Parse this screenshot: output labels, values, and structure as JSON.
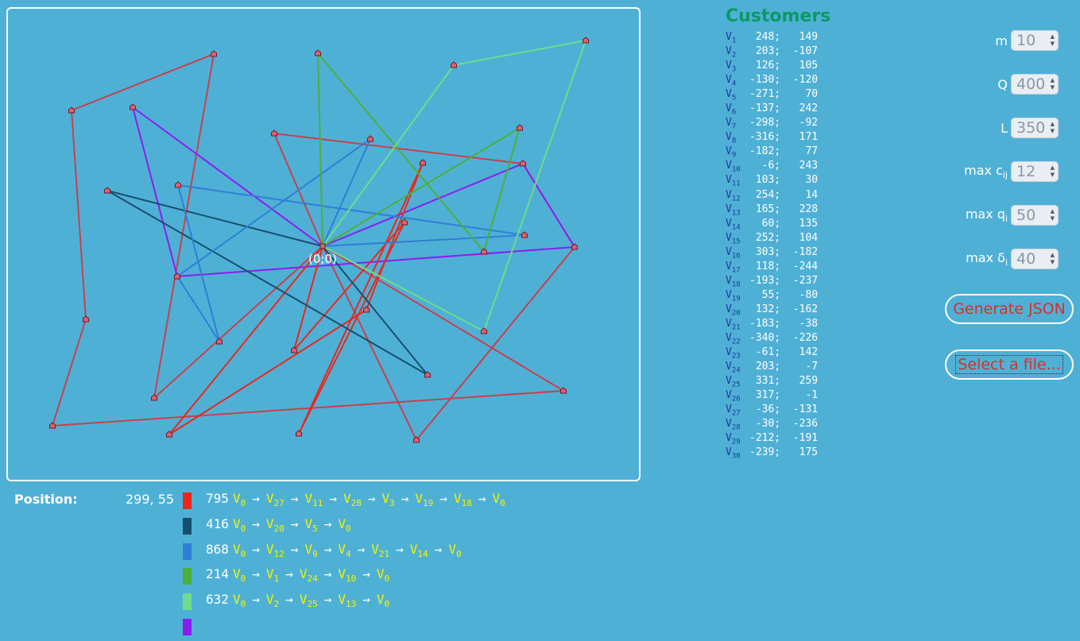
{
  "canvas": {
    "origin_label": "(0;0)",
    "nodes": [
      [
        248,
        149
      ],
      [
        203,
        -107
      ],
      [
        126,
        105
      ],
      [
        -130,
        -120
      ],
      [
        -271,
        70
      ],
      [
        -137,
        242
      ],
      [
        -298,
        -92
      ],
      [
        -316,
        171
      ],
      [
        -182,
        77
      ],
      [
        -6,
        243
      ],
      [
        103,
        30
      ],
      [
        254,
        14
      ],
      [
        165,
        228
      ],
      [
        60,
        135
      ],
      [
        252,
        104
      ],
      [
        303,
        -182
      ],
      [
        118,
        -244
      ],
      [
        -193,
        -237
      ],
      [
        55,
        -80
      ],
      [
        132,
        -162
      ],
      [
        -183,
        -38
      ],
      [
        -340,
        -226
      ],
      [
        -61,
        142
      ],
      [
        203,
        -7
      ],
      [
        331,
        259
      ],
      [
        317,
        -1
      ],
      [
        -36,
        -131
      ],
      [
        -30,
        -236
      ],
      [
        -212,
        -191
      ],
      [
        -239,
        175
      ]
    ]
  },
  "position": {
    "label": "Position:",
    "value": "299, 55"
  },
  "routes": [
    {
      "color": "#e8281c",
      "cost": "795",
      "path": [
        0,
        27,
        11,
        28,
        3,
        19,
        18,
        0
      ]
    },
    {
      "color": "#16506e",
      "cost": "416",
      "path": [
        0,
        20,
        5,
        0
      ]
    },
    {
      "color": "#2f7fd6",
      "cost": "868",
      "path": [
        0,
        12,
        9,
        4,
        21,
        14,
        0
      ]
    },
    {
      "color": "#4bb038",
      "cost": "214",
      "path": [
        0,
        1,
        24,
        10,
        0
      ]
    },
    {
      "color": "#6edc88",
      "cost": "632",
      "path": [
        0,
        2,
        25,
        13,
        0
      ]
    },
    {
      "color": "#8a1ef0",
      "cost": "",
      "path": []
    }
  ],
  "extra_routes": [
    {
      "color": "#c8404c",
      "path": [
        0,
        29,
        6,
        8,
        7,
        22,
        16,
        0
      ]
    },
    {
      "color": "#c8404c",
      "path": [
        0,
        17,
        26,
        15,
        23,
        0
      ]
    },
    {
      "color": "#8a1ef0",
      "path": [
        0,
        30,
        21,
        26,
        15,
        0
      ]
    }
  ],
  "customers": {
    "title": "Customers",
    "list": [
      {
        "n": "1",
        "x": "248",
        "y": "149"
      },
      {
        "n": "2",
        "x": "203",
        "y": "-107"
      },
      {
        "n": "3",
        "x": "126",
        "y": "105"
      },
      {
        "n": "4",
        "x": "-130",
        "y": "-120"
      },
      {
        "n": "5",
        "x": "-271",
        "y": "70"
      },
      {
        "n": "6",
        "x": "-137",
        "y": "242"
      },
      {
        "n": "7",
        "x": "-298",
        "y": "-92"
      },
      {
        "n": "8",
        "x": "-316",
        "y": "171"
      },
      {
        "n": "9",
        "x": "-182",
        "y": "77"
      },
      {
        "n": "10",
        "x": "-6",
        "y": "243"
      },
      {
        "n": "11",
        "x": "103",
        "y": "30"
      },
      {
        "n": "12",
        "x": "254",
        "y": "14"
      },
      {
        "n": "13",
        "x": "165",
        "y": "228"
      },
      {
        "n": "14",
        "x": "60",
        "y": "135"
      },
      {
        "n": "15",
        "x": "252",
        "y": "104"
      },
      {
        "n": "16",
        "x": "303",
        "y": "-182"
      },
      {
        "n": "17",
        "x": "118",
        "y": "-244"
      },
      {
        "n": "18",
        "x": "-193",
        "y": "-237"
      },
      {
        "n": "19",
        "x": "55",
        "y": "-80"
      },
      {
        "n": "20",
        "x": "132",
        "y": "-162"
      },
      {
        "n": "21",
        "x": "-183",
        "y": "-38"
      },
      {
        "n": "22",
        "x": "-340",
        "y": "-226"
      },
      {
        "n": "23",
        "x": "-61",
        "y": "142"
      },
      {
        "n": "24",
        "x": "203",
        "y": "-7"
      },
      {
        "n": "25",
        "x": "331",
        "y": "259"
      },
      {
        "n": "26",
        "x": "317",
        "y": "-1"
      },
      {
        "n": "27",
        "x": "-36",
        "y": "-131"
      },
      {
        "n": "28",
        "x": "-30",
        "y": "-236"
      },
      {
        "n": "29",
        "x": "-212",
        "y": "-191"
      },
      {
        "n": "30",
        "x": "-239",
        "y": "175"
      }
    ]
  },
  "params": [
    {
      "label": "m",
      "sub": "",
      "value": "10"
    },
    {
      "label": "Q",
      "sub": "",
      "value": "400"
    },
    {
      "label": "L",
      "sub": "",
      "value": "350"
    },
    {
      "label": "max c",
      "sub": "ij",
      "value": "12"
    },
    {
      "label": "max q",
      "sub": "i",
      "value": "50"
    },
    {
      "label": "max δ",
      "sub": "i",
      "value": "40"
    }
  ],
  "buttons": {
    "generate": "Generate JSON",
    "select_file": "Select a file..."
  }
}
